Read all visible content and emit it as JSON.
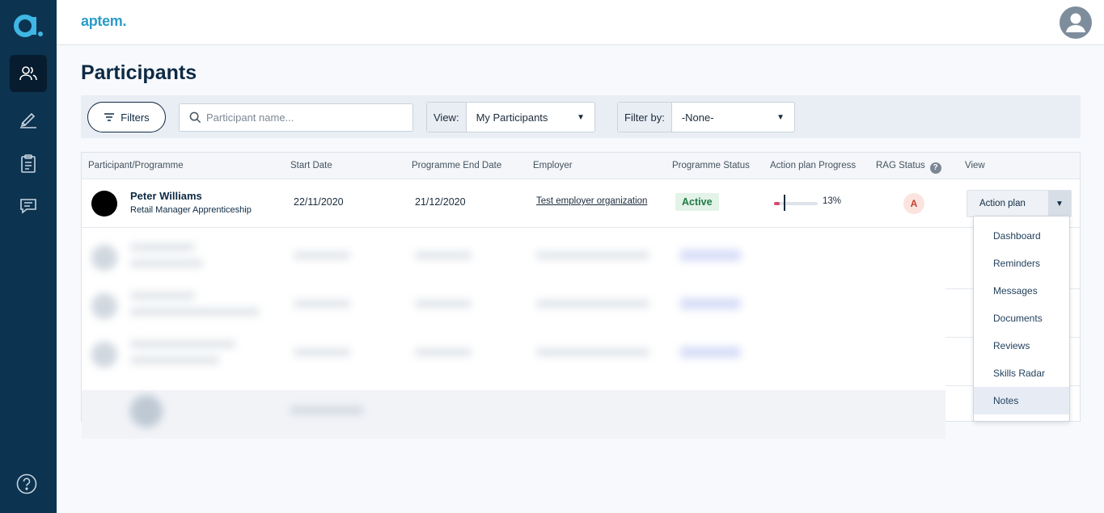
{
  "app": {
    "brand": "aptem"
  },
  "rail": {
    "items": [
      {
        "icon": "participants-icon",
        "active": true
      },
      {
        "icon": "pen-icon",
        "active": false
      },
      {
        "icon": "clipboard-icon",
        "active": false
      },
      {
        "icon": "messages-icon",
        "active": false
      }
    ],
    "help_icon": "help-icon"
  },
  "page": {
    "title": "Participants"
  },
  "filterbar": {
    "filters_label": "Filters",
    "search_placeholder": "Participant name...",
    "view_label": "View:",
    "view_value": "My Participants",
    "filterby_label": "Filter by:",
    "filterby_value": "-None-"
  },
  "table": {
    "headers": {
      "participant": "Participant/Programme",
      "start": "Start Date",
      "end": "Programme End Date",
      "employer": "Employer",
      "status": "Programme Status",
      "progress": "Action plan Progress",
      "rag": "RAG Status",
      "view": "View"
    },
    "row": {
      "name": "Peter Williams",
      "programme": "Retail Manager Apprenticeship",
      "start": "22/11/2020",
      "end": "21/12/2020",
      "employer": "Test employer organization",
      "status": "Active",
      "progress_label": "13%",
      "progress_value": 0.13,
      "rag": "A",
      "view_label": "Action plan"
    }
  },
  "menu": {
    "items": [
      "Dashboard",
      "Reminders",
      "Messages",
      "Documents",
      "Reviews",
      "Skills Radar",
      "Notes"
    ],
    "hovered": "Notes"
  },
  "colors": {
    "rail": "#0c3350",
    "brand": "#2c9cc8",
    "active_status": "#1f7a44",
    "rag_amber": "#c2412d",
    "progress": "#d64a6e"
  }
}
